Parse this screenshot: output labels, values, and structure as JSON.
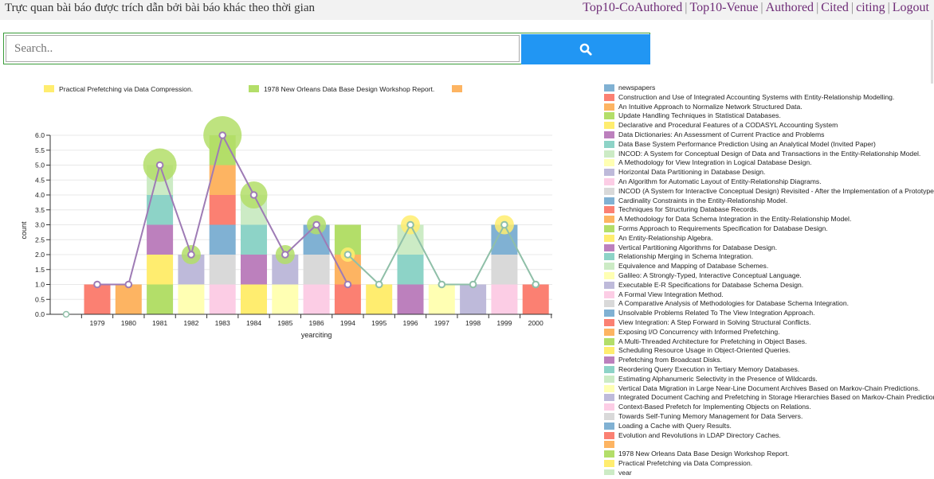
{
  "header": {
    "title": "Trực quan bài báo được trích dẫn bởi bài báo khác theo thời gian",
    "nav": [
      "Top10-CoAuthored",
      "Top10-Venue",
      "Authored",
      "Cited",
      "citing",
      "Logout"
    ]
  },
  "search": {
    "placeholder": "Search..",
    "button_icon": "search-icon"
  },
  "chart_top_legend": [
    {
      "label": "Practical Prefetching via Data Compression.",
      "color": "#ffed6f"
    },
    {
      "label": "1978 New Orleans Data Base Design Workshop Report.",
      "color": "#b3de69"
    },
    {
      "label": "",
      "color": "#fdb462"
    }
  ],
  "chart_data": {
    "type": "bar",
    "xlabel": "yearciting",
    "ylabel": "count",
    "ylim": [
      0,
      6
    ],
    "y_ticks": [
      "0.0",
      "0.5",
      "1.0",
      "1.5",
      "2.0",
      "2.5",
      "3.0",
      "3.5",
      "4.0",
      "4.5",
      "5.0",
      "5.5",
      "6.0"
    ],
    "categories": [
      "1979",
      "1980",
      "1981",
      "1982",
      "1983",
      "1984",
      "1985",
      "1986",
      "1994",
      "1995",
      "1996",
      "1997",
      "1998",
      "1999",
      "2000"
    ],
    "totals": [
      1,
      1,
      5,
      2,
      6,
      4,
      2,
      3,
      1,
      1,
      3,
      1,
      1,
      3,
      1
    ],
    "stacks": [
      [
        {
          "value": 1,
          "color": "#fb8072"
        }
      ],
      [
        {
          "value": 1,
          "color": "#fdb462"
        }
      ],
      [
        {
          "value": 1,
          "color": "#b3de69"
        },
        {
          "value": 1,
          "color": "#ffed6f"
        },
        {
          "value": 1,
          "color": "#bc80bd"
        },
        {
          "value": 1,
          "color": "#8dd3c7"
        },
        {
          "value": 1,
          "color": "#ccebc5"
        }
      ],
      [
        {
          "value": 1,
          "color": "#ffffb3"
        },
        {
          "value": 1,
          "color": "#bebada"
        }
      ],
      [
        {
          "value": 1,
          "color": "#fccde5"
        },
        {
          "value": 1,
          "color": "#d9d9d9"
        },
        {
          "value": 1,
          "color": "#80b1d3"
        },
        {
          "value": 1,
          "color": "#fb8072"
        },
        {
          "value": 1,
          "color": "#fdb462"
        },
        {
          "value": 1,
          "color": "#b3de69"
        }
      ],
      [
        {
          "value": 1,
          "color": "#ffed6f"
        },
        {
          "value": 1,
          "color": "#bc80bd"
        },
        {
          "value": 1,
          "color": "#8dd3c7"
        },
        {
          "value": 1,
          "color": "#ccebc5"
        }
      ],
      [
        {
          "value": 1,
          "color": "#ffffb3"
        },
        {
          "value": 1,
          "color": "#bebada"
        }
      ],
      [
        {
          "value": 1,
          "color": "#fccde5"
        },
        {
          "value": 1,
          "color": "#d9d9d9"
        },
        {
          "value": 1,
          "color": "#80b1d3"
        }
      ],
      [
        {
          "value": 1,
          "color": "#fb8072"
        },
        {
          "value": 1,
          "color": "#fdb462"
        },
        {
          "value": 1,
          "color": "#b3de69"
        }
      ],
      [
        {
          "value": 1,
          "color": "#ffed6f"
        }
      ],
      [
        {
          "value": 1,
          "color": "#bc80bd"
        },
        {
          "value": 1,
          "color": "#8dd3c7"
        },
        {
          "value": 1,
          "color": "#ccebc5"
        }
      ],
      [
        {
          "value": 1,
          "color": "#ffffb3"
        }
      ],
      [
        {
          "value": 1,
          "color": "#bebada"
        }
      ],
      [
        {
          "value": 1,
          "color": "#fccde5"
        },
        {
          "value": 1,
          "color": "#d9d9d9"
        },
        {
          "value": 1,
          "color": "#80b1d3"
        }
      ],
      [
        {
          "value": 1,
          "color": "#fb8072"
        }
      ]
    ],
    "line_series": [
      {
        "color": "#9e7bb5",
        "points": [
          [
            0,
            "1979",
            1
          ],
          [
            1,
            "1980",
            1
          ],
          [
            2,
            "1981",
            5
          ],
          [
            3,
            "1982",
            2
          ],
          [
            4,
            "1983",
            6
          ],
          [
            5,
            "1984",
            4
          ],
          [
            6,
            "1985",
            2
          ],
          [
            7,
            "1986",
            3
          ],
          [
            8,
            "1994",
            1
          ]
        ]
      },
      {
        "color": "#8fbfa8",
        "points": [
          [
            8,
            "1994",
            2
          ],
          [
            9,
            "1995",
            1
          ],
          [
            10,
            "1996",
            3
          ],
          [
            11,
            "1997",
            1
          ],
          [
            12,
            "1998",
            1
          ],
          [
            13,
            "1999",
            3
          ],
          [
            14,
            "2000",
            1
          ]
        ]
      }
    ],
    "bubbles": [
      {
        "category": "1981",
        "value": 5,
        "size": "large",
        "color": "#b3de69"
      },
      {
        "category": "1982",
        "value": 2,
        "size": "small",
        "color": "#b3de69"
      },
      {
        "category": "1983",
        "value": 6,
        "size": "xlarge",
        "color": "#b3de69"
      },
      {
        "category": "1984",
        "value": 4,
        "size": "medium",
        "color": "#b3de69"
      },
      {
        "category": "1985",
        "value": 2,
        "size": "small",
        "color": "#b3de69"
      },
      {
        "category": "1986",
        "value": 3,
        "size": "small",
        "color": "#b3de69"
      },
      {
        "category": "1994",
        "value": 2,
        "size": "tiny",
        "color": "#ffed6f"
      },
      {
        "category": "1996",
        "value": 3,
        "size": "small",
        "color": "#ffed6f"
      },
      {
        "category": "1999",
        "value": 3,
        "size": "small",
        "color": "#ffed6f"
      }
    ],
    "origin_point": {
      "value": 0
    },
    "grid": true
  },
  "legend_items": [
    {
      "label": "newspapers",
      "color": "#80b1d3"
    },
    {
      "label": "Construction and Use of Integrated Accounting Systems with Entity-Relationship Modelling.",
      "color": "#fb8072"
    },
    {
      "label": "An Intuitive Approach to Normalize Network Structured Data.",
      "color": "#fdb462"
    },
    {
      "label": "Update Handling Techniques in Statistical Databases.",
      "color": "#b3de69"
    },
    {
      "label": "Declarative and Procedural Features of a CODASYL Accounting System",
      "color": "#ffed6f"
    },
    {
      "label": "Data Dictionaries: An Assessment of Current Practice and Problems",
      "color": "#bc80bd"
    },
    {
      "label": "Data Base System Performance Prediction Using an Analytical Model (Invited Paper)",
      "color": "#8dd3c7"
    },
    {
      "label": "INCOD: A System for Conceptual Design of Data and Transactions in the Entity-Relationship Model.",
      "color": "#ccebc5"
    },
    {
      "label": "A Methodology for View Integration in Logical Database Design.",
      "color": "#ffffb3"
    },
    {
      "label": "Horizontal Data Partitioning in Database Design.",
      "color": "#bebada"
    },
    {
      "label": "An Algorithm for Automatic Layout of Entity-Relationship Diagrams.",
      "color": "#fccde5"
    },
    {
      "label": "INCOD (A System for Interactive Conceptual Design) Revisited - After the Implementation of a Prototype.",
      "color": "#d9d9d9"
    },
    {
      "label": "Cardinality Constraints in the Entity-Relationship Model.",
      "color": "#80b1d3"
    },
    {
      "label": "Techniques for Structuring Database Records.",
      "color": "#fb8072"
    },
    {
      "label": "A Methodology for Data Schema Integration in the Entity-Relationship Model.",
      "color": "#fdb462"
    },
    {
      "label": "Forms Approach to Requirements Specification for Database Design.",
      "color": "#b3de69"
    },
    {
      "label": "An Entity-Relationship Algebra.",
      "color": "#ffed6f"
    },
    {
      "label": "Vertical Partitioning Algorithms for Database Design.",
      "color": "#bc80bd"
    },
    {
      "label": "Relationship Merging in Schema Integration.",
      "color": "#8dd3c7"
    },
    {
      "label": "Equivalence and Mapping of Database Schemes.",
      "color": "#ccebc5"
    },
    {
      "label": "Galileo: A Strongly-Typed, Interactive Conceptual Language.",
      "color": "#ffffb3"
    },
    {
      "label": "Executable E-R Specifications for Database Schema Design.",
      "color": "#bebada"
    },
    {
      "label": "A Formal View Integration Method.",
      "color": "#fccde5"
    },
    {
      "label": "A Comparative Analysis of Methodologies for Database Schema Integration.",
      "color": "#d9d9d9"
    },
    {
      "label": "Unsolvable Problems Related To The View Integration Approach.",
      "color": "#80b1d3"
    },
    {
      "label": "View Integration: A Step Forward in Solving Structural Conflicts.",
      "color": "#fb8072"
    },
    {
      "label": "Exposing I/O Concurrency with Informed Prefetching.",
      "color": "#fdb462"
    },
    {
      "label": "A Multi-Threaded Architecture for Prefetching in Object Bases.",
      "color": "#b3de69"
    },
    {
      "label": "Scheduling Resource Usage in Object-Oriented Queries.",
      "color": "#ffed6f"
    },
    {
      "label": "Prefetching from Broadcast Disks.",
      "color": "#bc80bd"
    },
    {
      "label": "Reordering Query Execution in Tertiary Memory Databases.",
      "color": "#8dd3c7"
    },
    {
      "label": "Estimating Alphanumeric Selectivity in the Presence of Wildcards.",
      "color": "#ccebc5"
    },
    {
      "label": "Vertical Data Migration in Large Near-Line Document Archives Based on Markov-Chain Predictions.",
      "color": "#ffffb3"
    },
    {
      "label": "Integrated Document Caching and Prefetching in Storage Hierarchies Based on Markov-Chain Predictions.",
      "color": "#bebada"
    },
    {
      "label": "Context-Based Prefetch for Implementing Objects on Relations.",
      "color": "#fccde5"
    },
    {
      "label": "Towards Self-Tuning Memory Management for Data Servers.",
      "color": "#d9d9d9"
    },
    {
      "label": "Loading a Cache with Query Results.",
      "color": "#80b1d3"
    },
    {
      "label": "Evolution and Revolutions in LDAP Directory Caches.",
      "color": "#fb8072"
    },
    {
      "label": "",
      "color": "#fdb462"
    },
    {
      "label": "1978 New Orleans Data Base Design Workshop Report.",
      "color": "#b3de69"
    },
    {
      "label": "Practical Prefetching via Data Compression.",
      "color": "#ffed6f"
    },
    {
      "label": "year",
      "color": "#ccebc5"
    }
  ]
}
